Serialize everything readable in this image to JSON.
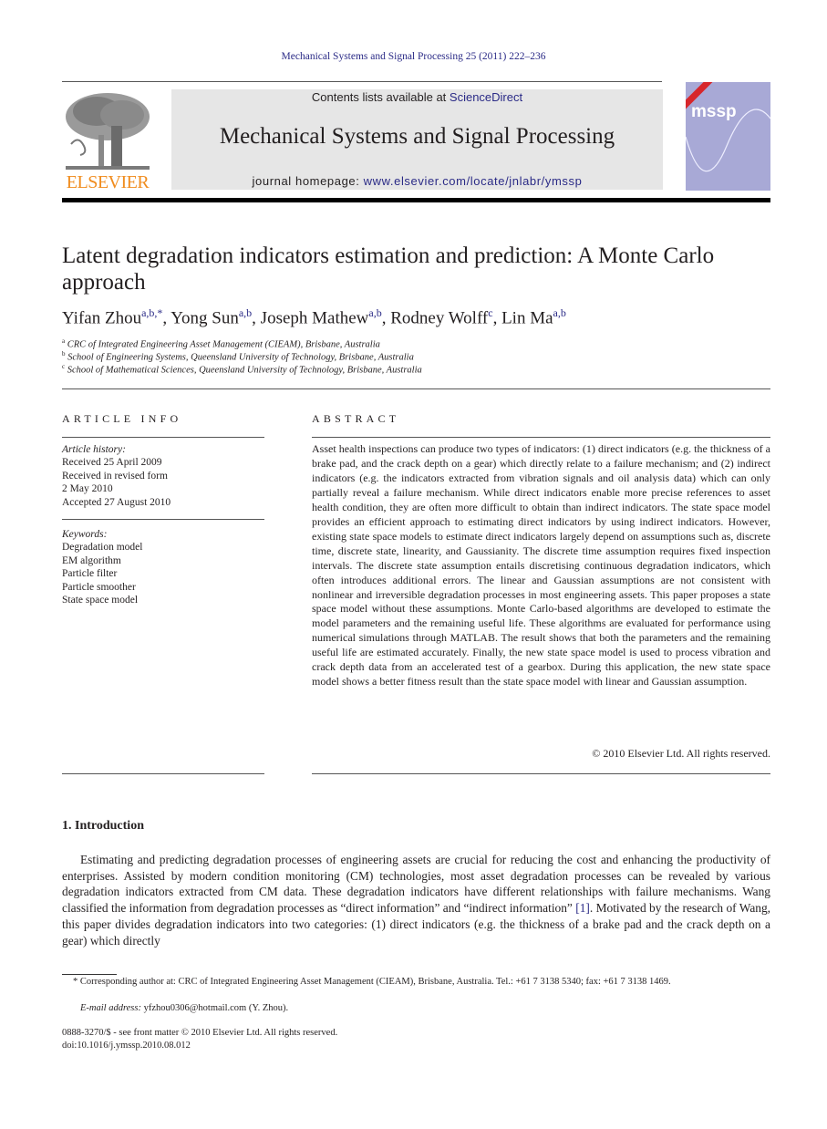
{
  "header": {
    "journal_ref": "Mechanical Systems and Signal Processing 25 (2011) 222–236",
    "contents_prefix": "Contents lists available at ",
    "contents_link": "ScienceDirect",
    "journal_name": "Mechanical Systems and Signal Processing",
    "homepage_prefix": "journal homepage: ",
    "homepage_link": "www.elsevier.com/locate/jnlabr/ymssp",
    "publisher_logo": "ELSEVIER",
    "cover_title": "mssp"
  },
  "article": {
    "title": "Latent degradation indicators estimation and prediction: A Monte Carlo approach",
    "authors": [
      {
        "name": "Yifan Zhou",
        "sup": "a,b,*"
      },
      {
        "name": "Yong Sun",
        "sup": "a,b"
      },
      {
        "name": "Joseph Mathew",
        "sup": "a,b"
      },
      {
        "name": "Rodney Wolff",
        "sup": "c"
      },
      {
        "name": "Lin Ma",
        "sup": "a,b"
      }
    ],
    "affiliations": [
      {
        "key": "a",
        "text": "CRC of Integrated Engineering Asset Management (CIEAM), Brisbane, Australia"
      },
      {
        "key": "b",
        "text": "School of Engineering Systems, Queensland University of Technology, Brisbane, Australia"
      },
      {
        "key": "c",
        "text": "School of Mathematical Sciences, Queensland University of Technology, Brisbane, Australia"
      }
    ]
  },
  "article_info": {
    "heading": "ARTICLE INFO",
    "history_label": "Article history:",
    "history": [
      "Received 25 April 2009",
      "Received in revised form",
      "2 May 2010",
      "Accepted 27 August 2010"
    ],
    "keywords_label": "Keywords:",
    "keywords": [
      "Degradation model",
      "EM algorithm",
      "Particle filter",
      "Particle smoother",
      "State space model"
    ]
  },
  "abstract": {
    "heading": "ABSTRACT",
    "text": "Asset health inspections can produce two types of indicators: (1) direct indicators (e.g. the thickness of a brake pad, and the crack depth on a gear) which directly relate to a failure mechanism; and (2) indirect indicators (e.g. the indicators extracted from vibration signals and oil analysis data) which can only partially reveal a failure mechanism. While direct indicators enable more precise references to asset health condition, they are often more difficult to obtain than indirect indicators. The state space model provides an efficient approach to estimating direct indicators by using indirect indicators. However, existing state space models to estimate direct indicators largely depend on assumptions such as, discrete time, discrete state, linearity, and Gaussianity. The discrete time assumption requires fixed inspection intervals. The discrete state assumption entails discretising continuous degradation indicators, which often introduces additional errors. The linear and Gaussian assumptions are not consistent with nonlinear and irreversible degradation processes in most engineering assets. This paper proposes a state space model without these assumptions. Monte Carlo-based algorithms are developed to estimate the model parameters and the remaining useful life. These algorithms are evaluated for performance using numerical simulations through MATLAB. The result shows that both the parameters and the remaining useful life are estimated accurately. Finally, the new state space model is used to process vibration and crack depth data from an accelerated test of a gearbox. During this application, the new state space model shows a better fitness result than the state space model with linear and Gaussian assumption.",
    "copyright": "© 2010 Elsevier Ltd. All rights reserved."
  },
  "introduction": {
    "heading": "1.  Introduction",
    "text_before_ref": "Estimating and predicting degradation processes of engineering assets are crucial for reducing the cost and enhancing the productivity of enterprises. Assisted by modern condition monitoring (CM) technologies, most asset degradation processes can be revealed by various degradation indicators extracted from CM data. These degradation indicators have different relationships with failure mechanisms. Wang classified the information from degradation processes as “direct information” and “indirect information” ",
    "ref": "[1]",
    "text_after_ref": ". Motivated by the research of Wang, this paper divides degradation indicators into two categories: (1) direct indicators (e.g. the thickness of a brake pad and the crack depth on a gear) which directly"
  },
  "footnotes": {
    "corresponding": "* Corresponding author at: CRC of Integrated Engineering Asset Management (CIEAM), Brisbane, Australia. Tel.: +61 7 3138 5340; fax: +61 7 3138 1469.",
    "email_label": "E-mail address:",
    "email": " yfzhou0306@hotmail.com (Y. Zhou).",
    "issn": "0888-3270/$ - see front matter © 2010 Elsevier Ltd. All rights reserved.",
    "doi": "doi:10.1016/j.ymssp.2010.08.012"
  }
}
